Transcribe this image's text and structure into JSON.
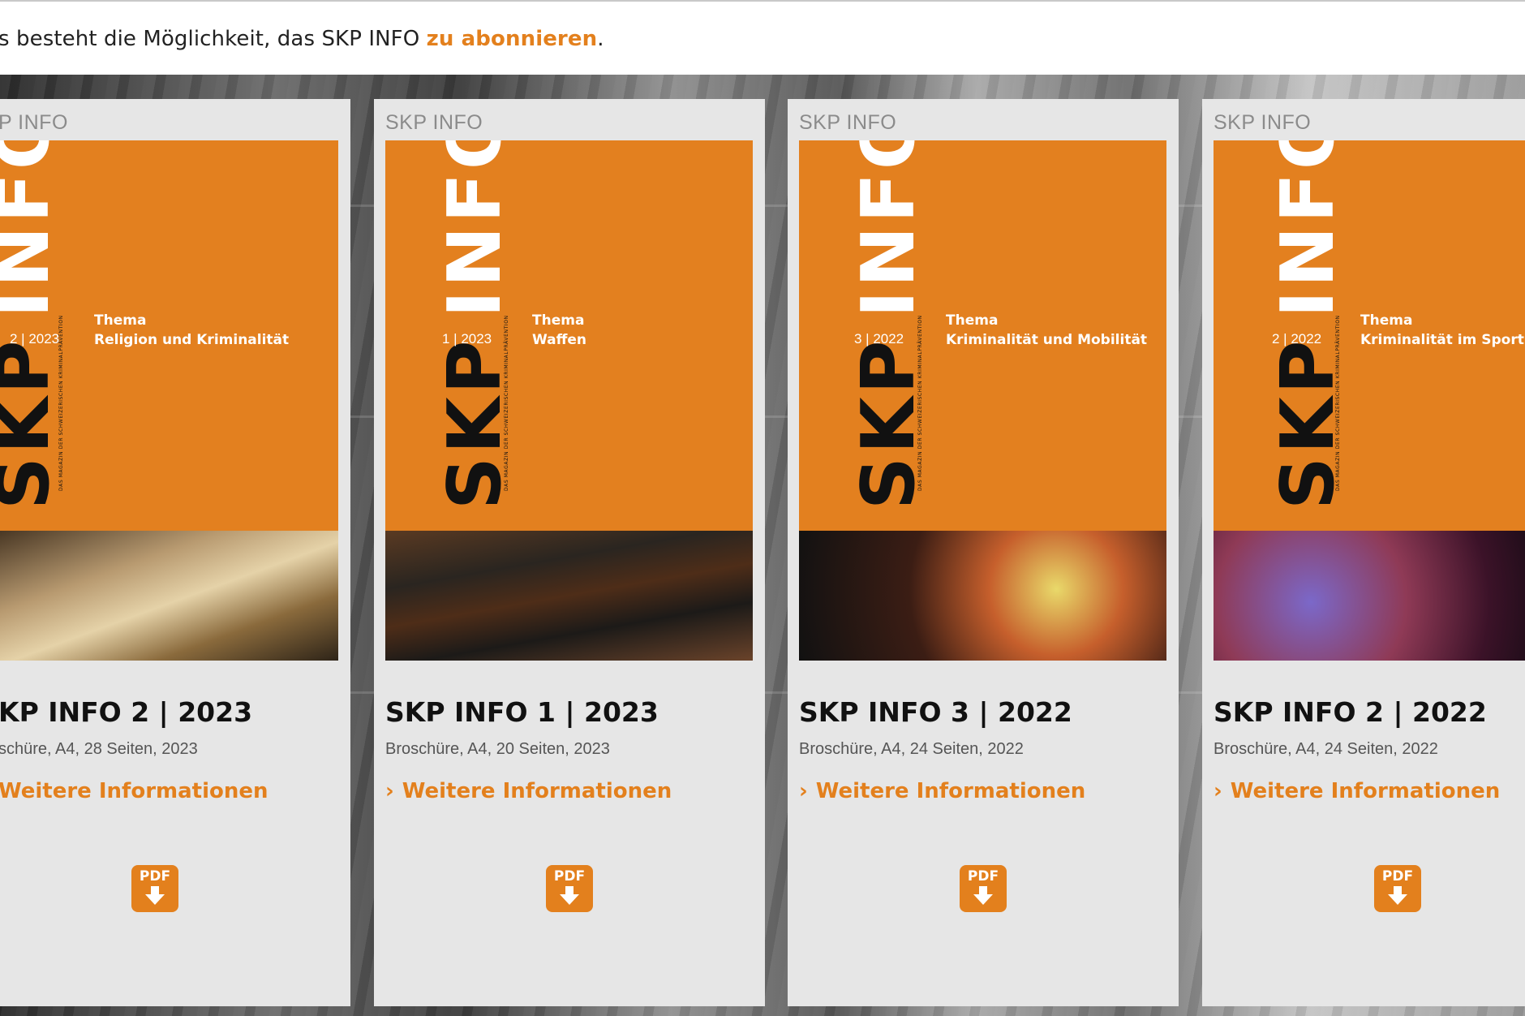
{
  "intro": {
    "text": "s besteht die Möglichkeit, das SKP INFO ",
    "link": "zu abonnieren",
    "end": "."
  },
  "cards": [
    {
      "small_title": "P INFO",
      "issue": "2 | 2023",
      "thema_label": "Thema",
      "thema": "Religion und Kriminalität",
      "title": "KP INFO 2 | 2023",
      "meta": "schüre, A4, 28 Seiten, 2023",
      "link": "Weitere Informationen",
      "pdf": "PDF"
    },
    {
      "small_title": "SKP INFO",
      "issue": "1 | 2023",
      "thema_label": "Thema",
      "thema": "Waffen",
      "title": "SKP INFO 1 | 2023",
      "meta": "Broschüre, A4, 20 Seiten, 2023",
      "link": "Weitere Informationen",
      "pdf": "PDF"
    },
    {
      "small_title": "SKP INFO",
      "issue": "3 | 2022",
      "thema_label": "Thema",
      "thema": "Kriminalität und Mobilität",
      "title": "SKP INFO 3 | 2022",
      "meta": "Broschüre, A4, 24 Seiten, 2022",
      "link": "Weitere Informationen",
      "pdf": "PDF"
    },
    {
      "small_title": "SKP INFO",
      "issue": "2 | 2022",
      "thema_label": "Thema",
      "thema": "Kriminalität im Sport",
      "title": "SKP INFO 2 | 2022",
      "meta": "Broschüre, A4, 24 Seiten, 2022",
      "link": "Weitere Informationen",
      "pdf": "PDF"
    }
  ],
  "cover": {
    "logo_skp": "SKP",
    "logo_info": "INFO",
    "tagline": "DAS MAGAZIN DER SCHWEIZERISCHEN KRIMINALPRÄVENTION"
  },
  "colors": {
    "accent": "#e3801d",
    "cover_orange": "#e3801f",
    "card_bg": "#e6e6e6"
  },
  "icons": {
    "chevron": "chevron-right-icon",
    "pdf": "pdf-download-icon"
  }
}
